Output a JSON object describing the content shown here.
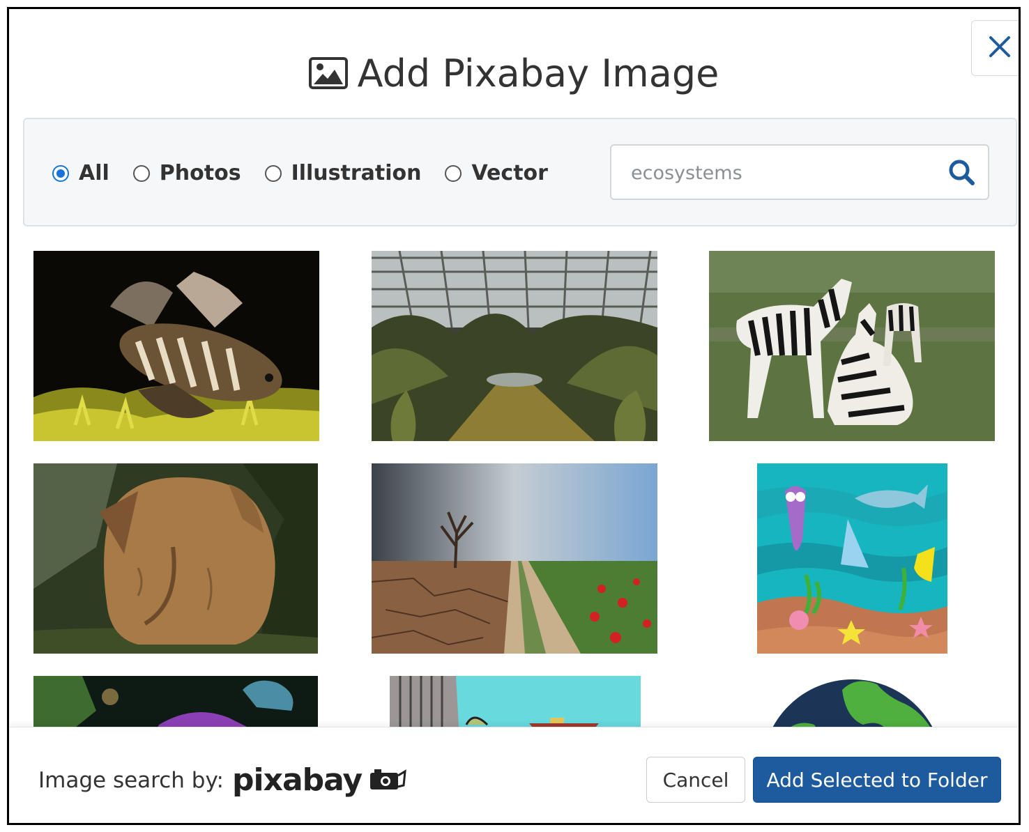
{
  "dialog": {
    "title": "Add Pixabay Image",
    "title_icon": "image-icon",
    "close_icon": "close-icon"
  },
  "filters": {
    "options": [
      {
        "label": "All",
        "checked": true
      },
      {
        "label": "Photos",
        "checked": false
      },
      {
        "label": "Illustration",
        "checked": false
      },
      {
        "label": "Vector",
        "checked": false
      }
    ],
    "search": {
      "value": "",
      "placeholder": "ecosystems",
      "icon": "search-icon"
    }
  },
  "results": [
    {
      "subject": "lionfish"
    },
    {
      "subject": "greenhouse-jungle"
    },
    {
      "subject": "zebras"
    },
    {
      "subject": "elephant"
    },
    {
      "subject": "drought-vs-field"
    },
    {
      "subject": "cartoon-sea-life"
    },
    {
      "subject": "coral-reef"
    },
    {
      "subject": "cartoon-boat"
    },
    {
      "subject": "earth-globe"
    }
  ],
  "footer": {
    "credit_label": "Image search by:",
    "brand": "pixabay",
    "cancel_label": "Cancel",
    "add_label": "Add Selected to Folder"
  },
  "colors": {
    "primary": "#1d5a9e",
    "radio_accent": "#1a73d9",
    "panel_bg": "#f5f7f9"
  }
}
